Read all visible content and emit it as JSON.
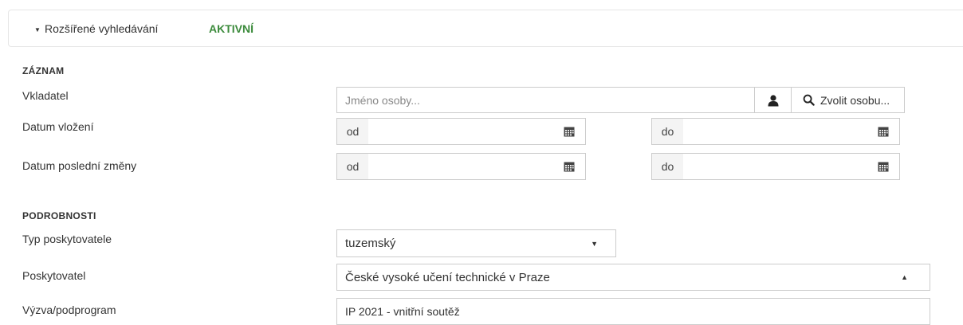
{
  "header": {
    "title": "Rozšířené vyhledávání",
    "status": "AKTIVNÍ"
  },
  "sections": {
    "zaznam": "ZÁZNAM",
    "podrobnosti": "PODROBNOSTI"
  },
  "fields": {
    "vkladatel": {
      "label": "Vkladatel",
      "placeholder": "Jméno osoby...",
      "choose_button": "Zvolit osobu..."
    },
    "datum_vlozeni": {
      "label": "Datum vložení",
      "from_label": "od",
      "to_label": "do"
    },
    "datum_zmeny": {
      "label": "Datum poslední změny",
      "from_label": "od",
      "to_label": "do"
    },
    "typ_poskytovatele": {
      "label": "Typ poskytovatele",
      "value": "tuzemský"
    },
    "poskytovatel": {
      "label": "Poskytovatel",
      "value": "České vysoké učení technické v Praze"
    },
    "vyzva": {
      "label": "Výzva/podprogram",
      "value": "IP 2021 - vnitřní soutěž"
    }
  },
  "colors": {
    "status_green": "#3c8b3c",
    "border": "#cccccc",
    "addon_bg": "#f4f4f4"
  },
  "icons": {
    "person": "person-icon",
    "search": "search-icon",
    "calendar": "calendar-icon",
    "caret_down": "caret-down-icon",
    "caret_up": "caret-up-icon"
  }
}
